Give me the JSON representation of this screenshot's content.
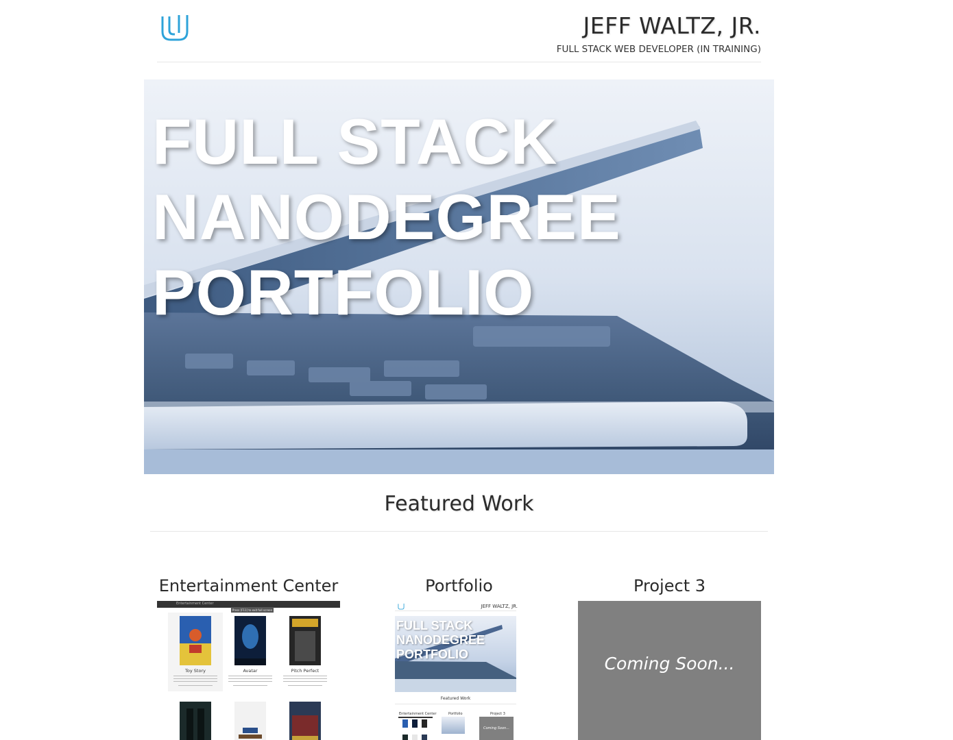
{
  "header": {
    "name": "JEFF WALTZ, JR.",
    "subtitle": "FULL STACK WEB DEVELOPER (IN TRAINING)",
    "logo_icon": "udacity-logo-icon",
    "accent": "#2ea3d9"
  },
  "hero": {
    "line1": "FULL STACK",
    "line2": "NANODEGREE",
    "line3": "PORTFOLIO"
  },
  "featured": {
    "title": "Featured Work"
  },
  "projects": [
    {
      "title": "Entertainment Center",
      "thumb": {
        "bar_title": "Entertainment Center",
        "tip": "Press [F11] to exit full screen",
        "movies": [
          "Toy Story",
          "Avatar",
          "Pitch Perfect"
        ]
      }
    },
    {
      "title": "Portfolio",
      "thumb": {
        "name": "JEFF WALTZ, JR.",
        "hero_line1": "FULL STACK",
        "hero_line2": "NANODEGREE",
        "hero_line3": "PORTFOLIO",
        "featured": "Featured Work",
        "p1": "Entertainment Center",
        "p2": "Portfolio",
        "p3": "Project 3",
        "coming": "Coming Soon..."
      }
    },
    {
      "title": "Project 3",
      "coming_soon": "Coming Soon..."
    }
  ]
}
